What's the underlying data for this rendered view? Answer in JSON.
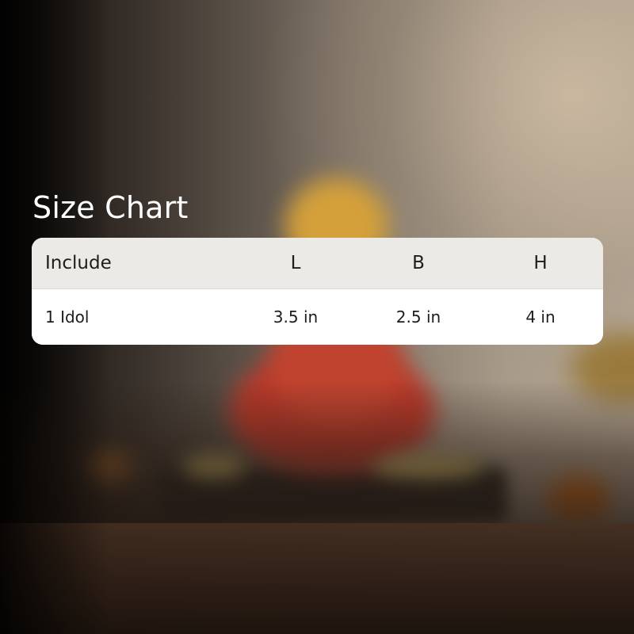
{
  "heading": "Size Chart",
  "table": {
    "columns": [
      "Include",
      "L",
      "B",
      "H"
    ],
    "rows": [
      [
        "1 Idol",
        "3.5 in",
        "2.5 in",
        "4 in"
      ]
    ]
  },
  "colors": {
    "card_background": "#ffffff",
    "header_background": "#eceae6",
    "heading_text": "#ffffff",
    "table_text": "#1f1c1a"
  }
}
